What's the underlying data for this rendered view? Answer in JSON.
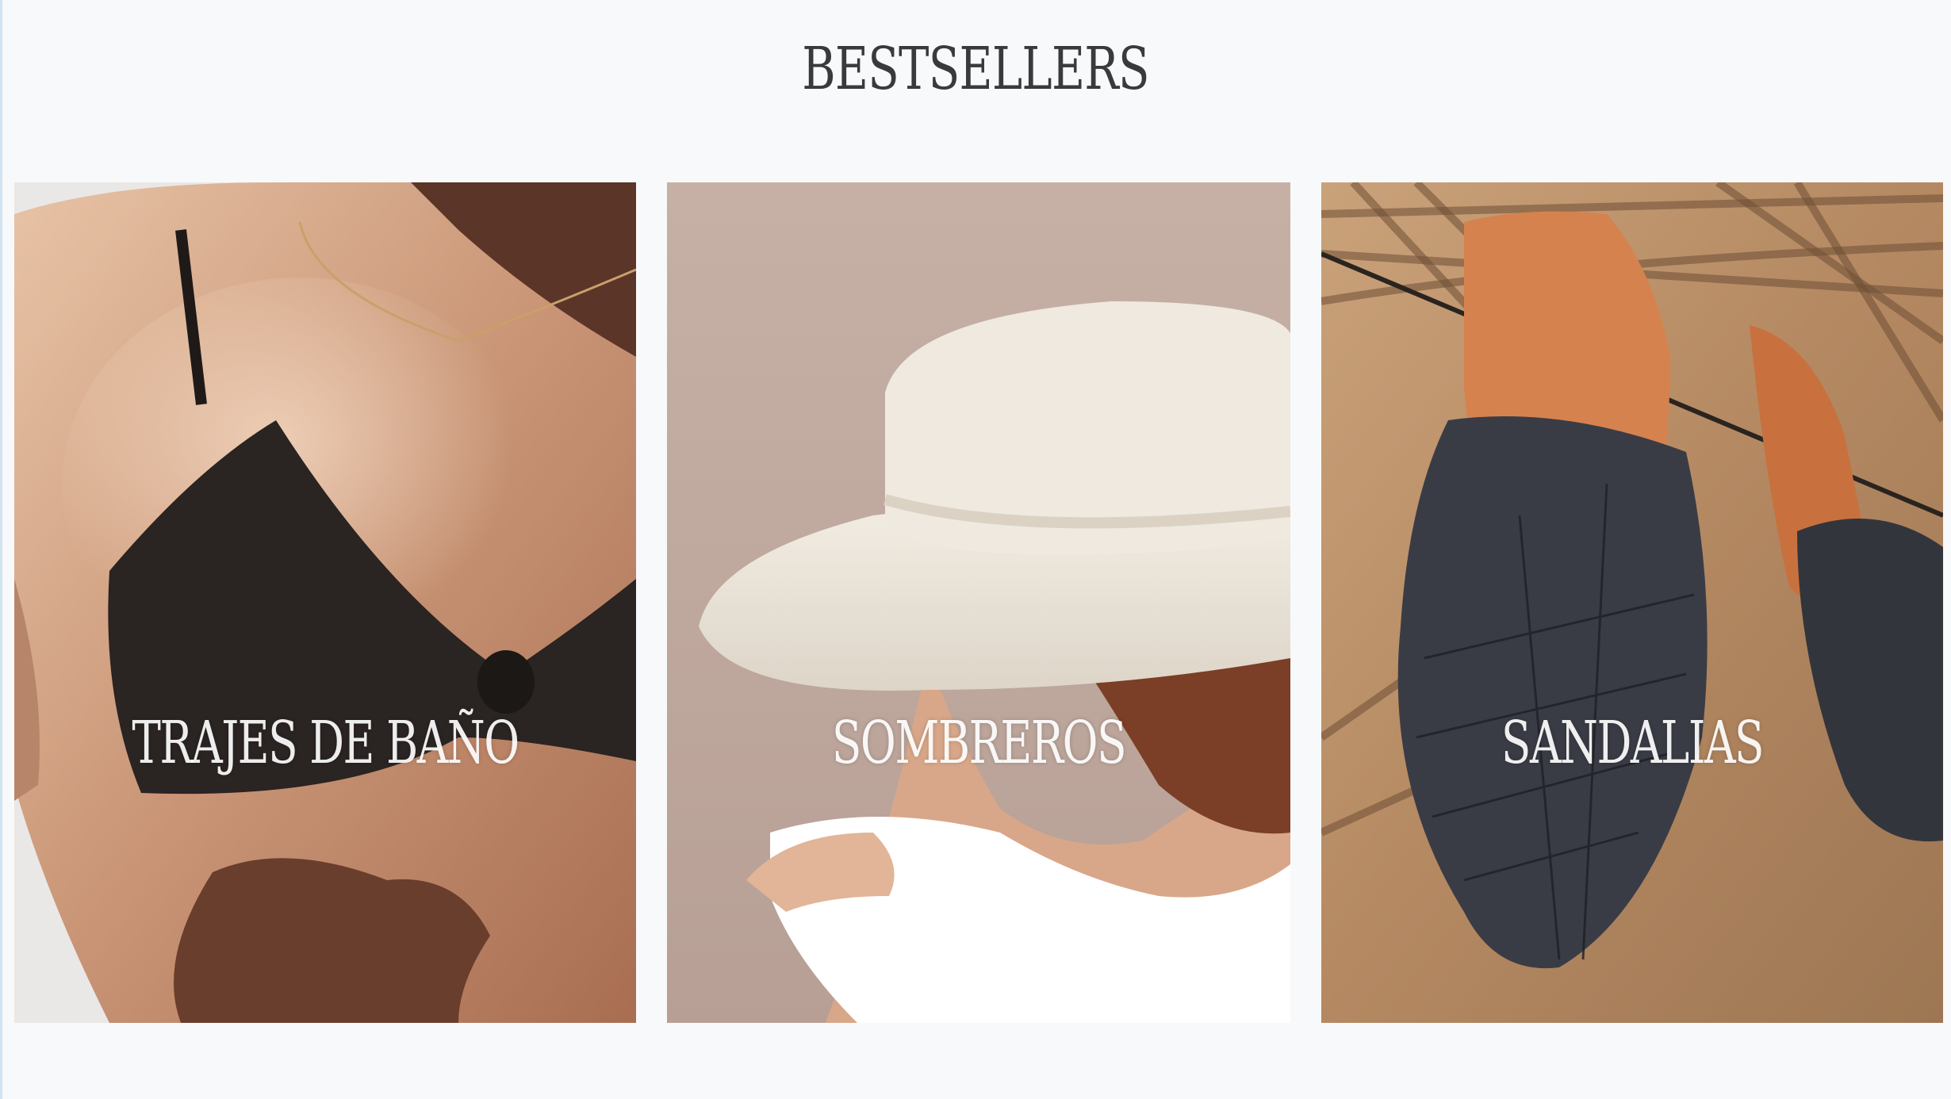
{
  "section": {
    "title": "BESTSELLERS"
  },
  "cards": [
    {
      "label": "TRAJES DE BAÑO",
      "image": "swimsuit-photo"
    },
    {
      "label": "SOMBREROS",
      "image": "hat-photo"
    },
    {
      "label": "SANDALIAS",
      "image": "sandals-photo"
    }
  ],
  "colors": {
    "background": "#f8f9fa",
    "title": "#3a3a3e",
    "label": "#ffffff"
  }
}
